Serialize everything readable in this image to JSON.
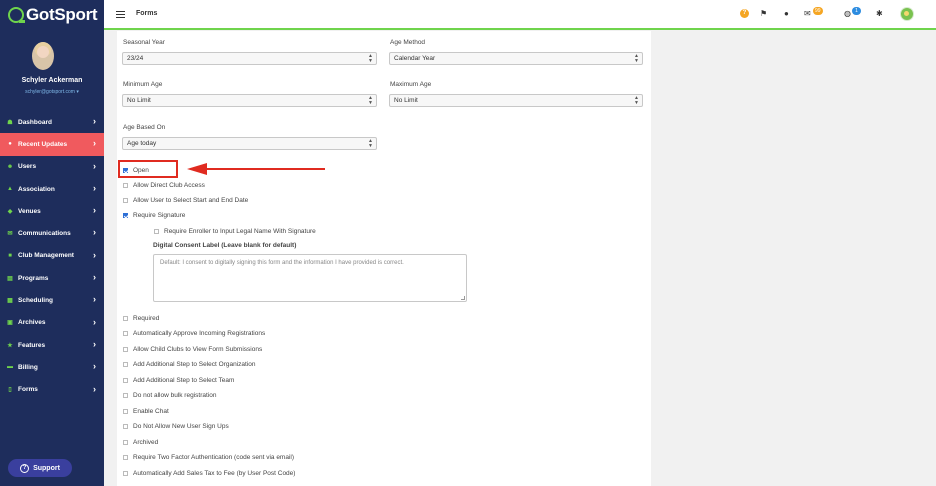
{
  "brand": {
    "logo_text": "GotSport"
  },
  "user": {
    "name": "Schyler Ackerman",
    "email": "schyler@gotsport.com"
  },
  "nav": [
    {
      "label": "Dashboard",
      "icon": "dashboard-icon",
      "active": false
    },
    {
      "label": "Recent Updates",
      "icon": "updates-icon",
      "active": true
    },
    {
      "label": "Users",
      "icon": "users-icon",
      "active": false
    },
    {
      "label": "Association",
      "icon": "association-icon",
      "active": false
    },
    {
      "label": "Venues",
      "icon": "venues-icon",
      "active": false
    },
    {
      "label": "Communications",
      "icon": "communications-icon",
      "active": false
    },
    {
      "label": "Club Management",
      "icon": "club-management-icon",
      "active": false
    },
    {
      "label": "Programs",
      "icon": "programs-icon",
      "active": false
    },
    {
      "label": "Scheduling",
      "icon": "scheduling-icon",
      "active": false
    },
    {
      "label": "Archives",
      "icon": "archives-icon",
      "active": false
    },
    {
      "label": "Features",
      "icon": "features-icon",
      "active": false
    },
    {
      "label": "Billing",
      "icon": "billing-icon",
      "active": false
    },
    {
      "label": "Forms",
      "icon": "forms-icon",
      "active": false
    }
  ],
  "support_label": "Support",
  "header": {
    "title": "Forms",
    "mail_badge": "99",
    "chat_badge": "1"
  },
  "form": {
    "seasonal_year": {
      "label": "Seasonal Year",
      "value": "23/24"
    },
    "age_method": {
      "label": "Age Method",
      "value": "Calendar Year"
    },
    "minimum_age": {
      "label": "Minimum Age",
      "value": "No Limit"
    },
    "maximum_age": {
      "label": "Maximum Age",
      "value": "No Limit"
    },
    "age_based_on": {
      "label": "Age Based On",
      "value": "Age today"
    },
    "checkboxes_top": [
      {
        "label": "Open",
        "checked": true
      },
      {
        "label": "Allow Direct Club Access",
        "checked": false
      },
      {
        "label": "Allow User to Select Start and End Date",
        "checked": false
      },
      {
        "label": "Require Signature",
        "checked": true
      }
    ],
    "require_legal_name": {
      "label": "Require Enroller to Input Legal Name With Signature",
      "checked": false
    },
    "consent_label": "Digital Consent Label (Leave blank for default)",
    "consent_placeholder": "Default: I consent to digitally signing this form and the information I have provided is correct.",
    "checkboxes_bottom": [
      {
        "label": "Required",
        "checked": false
      },
      {
        "label": "Automatically Approve Incoming Registrations",
        "checked": false
      },
      {
        "label": "Allow Child Clubs to View Form Submissions",
        "checked": false
      },
      {
        "label": "Add Additional Step to Select Organization",
        "checked": false
      },
      {
        "label": "Add Additional Step to Select Team",
        "checked": false
      },
      {
        "label": "Do not allow bulk registration",
        "checked": false
      },
      {
        "label": "Enable Chat",
        "checked": false
      },
      {
        "label": "Do Not Allow New User Sign Ups",
        "checked": false
      },
      {
        "label": "Archived",
        "checked": false
      },
      {
        "label": "Require Two Factor Authentication (code sent via email)",
        "checked": false
      },
      {
        "label": "Automatically Add Sales Tax to Fee (by User Post Code)",
        "checked": false
      }
    ]
  },
  "colors": {
    "sidebar": "#1e2d5c",
    "accent_green": "#6fd44c",
    "active_nav": "#f05a5e",
    "annotation_red": "#e02b20"
  }
}
